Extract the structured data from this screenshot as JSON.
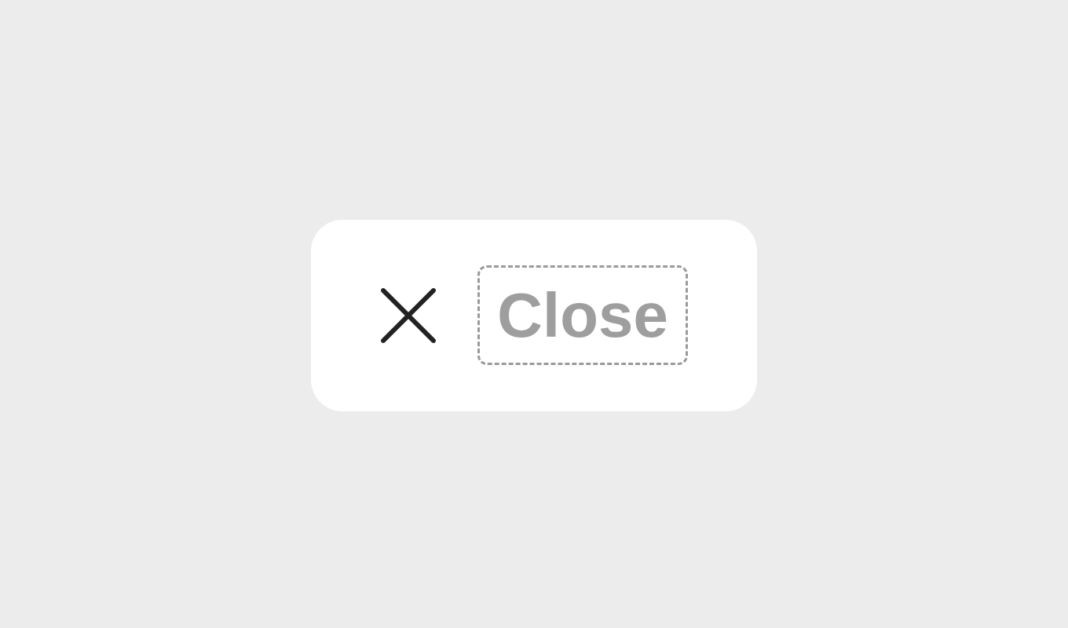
{
  "close_button": {
    "label": "Close",
    "icon": "close-icon"
  },
  "colors": {
    "background": "#ececec",
    "card": "#ffffff",
    "icon": "#222222",
    "label": "#9e9e9e",
    "dashed_border": "#9a9a9a"
  }
}
